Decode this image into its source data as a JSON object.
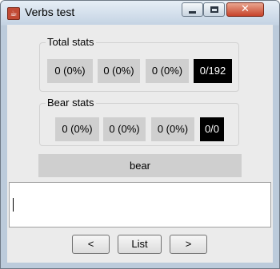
{
  "window": {
    "title": "Verbs test",
    "icon": "java-app-icon",
    "controls": [
      "minimize-icon",
      "maximize-icon",
      "close-icon"
    ],
    "close_glyph": "✕"
  },
  "total_stats": {
    "label": "Total stats",
    "values": [
      "0 (0%)",
      "0 (0%)",
      "0 (0%)"
    ],
    "count": "0/192"
  },
  "bear_stats": {
    "label": "Bear stats",
    "values": [
      "0 (0%)",
      "0 (0%)",
      "0 (0%)"
    ],
    "count": "0/0"
  },
  "current_verb": "bear",
  "answer_input": {
    "value": ""
  },
  "buttons": {
    "prev": "<",
    "list": "List",
    "next": ">"
  },
  "colors": {
    "stat_bg": "#cfcfcf",
    "count_bg": "#000000",
    "count_fg": "#ffffff"
  }
}
